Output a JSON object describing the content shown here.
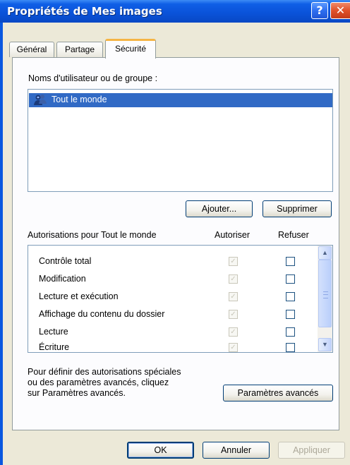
{
  "window": {
    "title": "Propriétés de Mes images",
    "help_label": "?",
    "close_label": "✕"
  },
  "tabs": [
    {
      "label": "Général",
      "selected": false
    },
    {
      "label": "Partage",
      "selected": false
    },
    {
      "label": "Sécurité",
      "selected": true
    }
  ],
  "security": {
    "users_label": "Noms d'utilisateur ou de groupe :",
    "users": [
      {
        "name": "Tout le monde",
        "icon": "user-group-icon",
        "selected": true
      }
    ],
    "add_button": "Ajouter...",
    "remove_button": "Supprimer",
    "permissions_label": "Autorisations pour Tout le monde",
    "allow_header": "Autoriser",
    "deny_header": "Refuser",
    "permissions": [
      {
        "name": "Contrôle total",
        "allow": true,
        "allow_disabled": true,
        "deny": false
      },
      {
        "name": "Modification",
        "allow": true,
        "allow_disabled": true,
        "deny": false
      },
      {
        "name": "Lecture et exécution",
        "allow": true,
        "allow_disabled": true,
        "deny": false
      },
      {
        "name": "Affichage du contenu du dossier",
        "allow": true,
        "allow_disabled": true,
        "deny": false
      },
      {
        "name": "Lecture",
        "allow": true,
        "allow_disabled": true,
        "deny": false
      },
      {
        "name": "Écriture",
        "allow": true,
        "allow_disabled": true,
        "deny": false
      }
    ],
    "advanced_text_line1": "Pour définir des autorisations spéciales",
    "advanced_text_line2": "ou des paramètres avancés, cliquez",
    "advanced_text_line3": "sur Paramètres avancés.",
    "advanced_button": "Paramètres avancés"
  },
  "footer": {
    "ok": "OK",
    "cancel": "Annuler",
    "apply": "Appliquer",
    "apply_disabled": true
  },
  "colors": {
    "titlebar": "#0a52d8",
    "selection": "#316ac5",
    "dialog_bg": "#ece9d8",
    "active_tab_accent": "#f5b545"
  }
}
